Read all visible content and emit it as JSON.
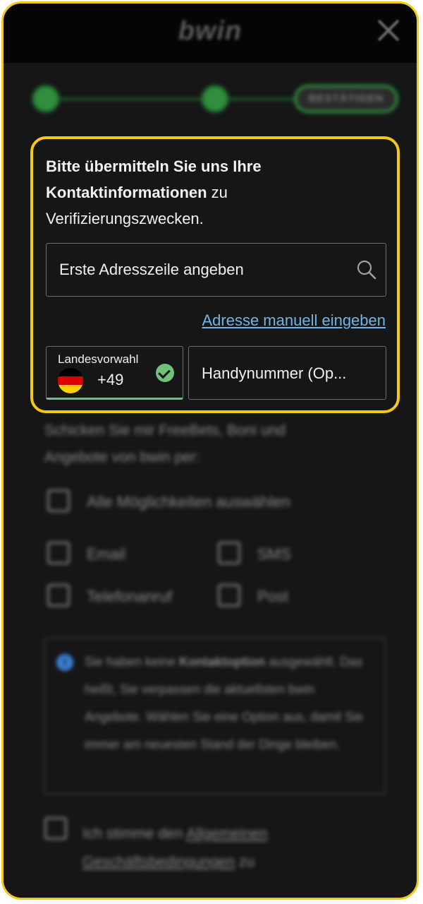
{
  "header": {
    "logo_text": "bwin"
  },
  "stepper": {
    "current_step_label": "BESTÄTIGEN"
  },
  "form": {
    "intro_bold_1": "Bitte übermitteln Sie uns Ihre",
    "intro_bold_2": "Kontaktinformationen",
    "intro_rest_1": " zu",
    "intro_rest_2": "Verifizierungszwecken.",
    "address_placeholder": "Erste Adresszeile angeben",
    "manual_address_link": "Adresse manuell eingeben",
    "country_code_label": "Landesvorwahl",
    "country_code_value": "+49",
    "phone_placeholder": "Handynummer (Op..."
  },
  "marketing": {
    "promo_text": "Schicken Sie mir FreeBets, Boni und Angebote von bwin per:",
    "select_all_label": "Alle Möglichkeiten auswählen",
    "options": [
      "Email",
      "SMS",
      "Telefonanruf",
      "Post"
    ]
  },
  "info": {
    "text_before": "Sie haben keine ",
    "text_bold": "Kontaktoption",
    "text_after": " ausgewählt. Das heißt, Sie verpassen die aktuellsten bwin Angebote. Wählen Sie eine Option aus, damit Sie immer am neuesten Stand der Dinge bleiben."
  },
  "terms": {
    "text_before": "Ich stimme den ",
    "link_text": "Allgemeinen Geschäftsbedingungen",
    "text_after": " zu"
  },
  "colors": {
    "highlight_border": "#f4c912",
    "link": "#6fb5ea",
    "success": "#6ec27a",
    "background": "#161616"
  }
}
